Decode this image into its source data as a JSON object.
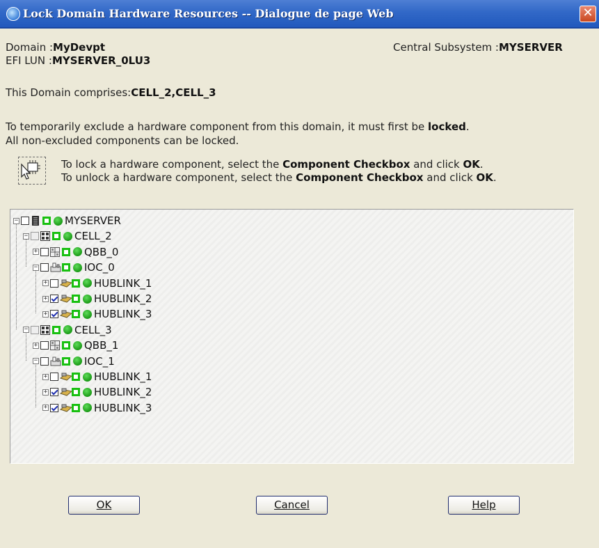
{
  "window": {
    "title": "Lock Domain Hardware Resources -- Dialogue de page Web",
    "close_glyph": "✕"
  },
  "info": {
    "domain_label": "Domain :",
    "domain_value": "MyDevpt",
    "efi_label": "EFI LUN :",
    "efi_value": "MYSERVER_0LU3",
    "subsystem_label": "Central Subsystem :",
    "subsystem_value": "MYSERVER",
    "comprises_label": "This Domain comprises:",
    "comprises_value": "CELL_2,CELL_3"
  },
  "description": {
    "line1_prefix": "To temporarily exclude a hardware component from this domain, it must first be ",
    "line1_bold": "locked",
    "line1_suffix": ".",
    "line2": "All non-excluded components can be locked."
  },
  "instructions": {
    "lock_prefix": "To lock a hardware component, select the ",
    "lock_bold": "Component Checkbox",
    "lock_mid": " and click ",
    "lock_ok": "OK",
    "lock_end": ".",
    "unlock_prefix": "To unlock a hardware component, select the ",
    "unlock_bold": "Component Checkbox",
    "unlock_mid": " and click ",
    "unlock_ok": "OK",
    "unlock_end": "."
  },
  "tree": [
    {
      "label": "MYSERVER",
      "level": 0,
      "expander": "−",
      "checked": false,
      "grey": false,
      "icon": "server-icon"
    },
    {
      "label": "CELL_2",
      "level": 1,
      "expander": "−",
      "checked": false,
      "grey": true,
      "icon": "cell-icon"
    },
    {
      "label": "QBB_0",
      "level": 2,
      "expander": "+",
      "checked": false,
      "grey": false,
      "icon": "qbb-icon"
    },
    {
      "label": "IOC_0",
      "level": 2,
      "expander": "−",
      "checked": false,
      "grey": false,
      "icon": "ioc-icon"
    },
    {
      "label": "HUBLINK_1",
      "level": 3,
      "expander": "+",
      "checked": false,
      "grey": false,
      "icon": "hublink-icon"
    },
    {
      "label": "HUBLINK_2",
      "level": 3,
      "expander": "+",
      "checked": true,
      "grey": false,
      "icon": "hublink-icon"
    },
    {
      "label": "HUBLINK_3",
      "level": 3,
      "expander": "+",
      "checked": true,
      "grey": false,
      "icon": "hublink-icon"
    },
    {
      "label": "CELL_3",
      "level": 1,
      "expander": "−",
      "checked": false,
      "grey": true,
      "icon": "cell-icon"
    },
    {
      "label": "QBB_1",
      "level": 2,
      "expander": "+",
      "checked": false,
      "grey": false,
      "icon": "qbb-icon"
    },
    {
      "label": "IOC_1",
      "level": 2,
      "expander": "−",
      "checked": false,
      "grey": false,
      "icon": "ioc-icon"
    },
    {
      "label": "HUBLINK_1",
      "level": 3,
      "expander": "+",
      "checked": false,
      "grey": false,
      "icon": "hublink-icon"
    },
    {
      "label": "HUBLINK_2",
      "level": 3,
      "expander": "+",
      "checked": true,
      "grey": false,
      "icon": "hublink-icon"
    },
    {
      "label": "HUBLINK_3",
      "level": 3,
      "expander": "+",
      "checked": true,
      "grey": false,
      "icon": "hublink-icon"
    }
  ],
  "buttons": {
    "ok": "OK",
    "cancel": "Cancel",
    "help": "Help"
  },
  "colors": {
    "titlebar": "#2a5fc4",
    "status_green": "#18c010",
    "dialog_bg": "#ece9d8"
  }
}
